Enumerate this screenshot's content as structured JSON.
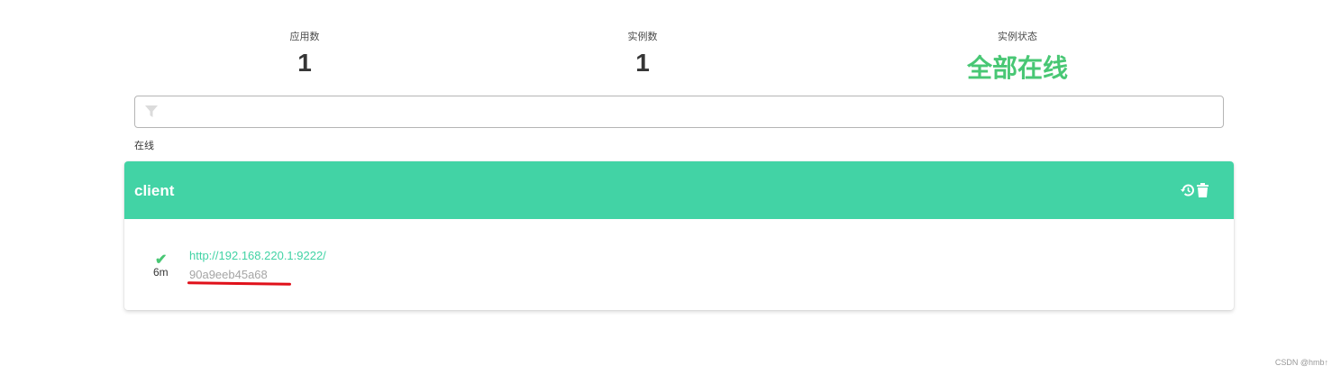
{
  "stats": [
    {
      "label": "应用数",
      "value": "1"
    },
    {
      "label": "实例数",
      "value": "1"
    },
    {
      "label": "实例状态",
      "value": "全部在线"
    }
  ],
  "filter": {
    "placeholder": "",
    "value": ""
  },
  "section_label": "在线",
  "application": {
    "name": "client",
    "actions": [
      "history-icon",
      "trash-icon"
    ],
    "instance": {
      "status": "up",
      "age": "6m",
      "url": "http://192.168.220.1:9222/",
      "id": "90a9eeb45a68"
    }
  },
  "watermark": "CSDN @hmb↑",
  "colors": {
    "accent": "#42d3a5",
    "success": "#48c774"
  }
}
